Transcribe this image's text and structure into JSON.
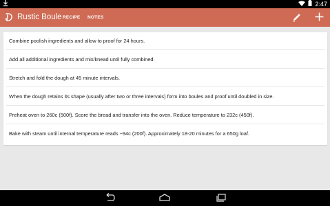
{
  "status_bar": {
    "time": "2:47"
  },
  "action_bar": {
    "title": "Rustic Boule",
    "tabs": [
      {
        "label": "RECIPE"
      },
      {
        "label": "NOTES"
      }
    ],
    "color": "#cf6b55"
  },
  "steps": [
    "Combine poolish ingredients and allow to proof for 24 hours.",
    "Add all additional ingredients and mix/knead until fully combined.",
    "Stretch and fold the dough at 45 minute intervals.",
    "When the dough retains its shape (usually after two or three intervals) form into boules and proof until doubled in size.",
    "Preheat oven to 260c (500f). Score the bread and transfer into the oven. Reduce temperature to 232c (450f).",
    "Bake with steam until internal temperature reads ~94c (200f). Approximately 18-20 minutes for a 650g loaf."
  ],
  "icons": {
    "download": "download-icon",
    "wifi": "wifi-icon",
    "battery": "battery-icon",
    "app": "app-logo-icon",
    "edit": "pencil-icon",
    "add": "plus-icon",
    "back": "back-icon",
    "home": "home-icon",
    "recents": "recents-icon"
  }
}
